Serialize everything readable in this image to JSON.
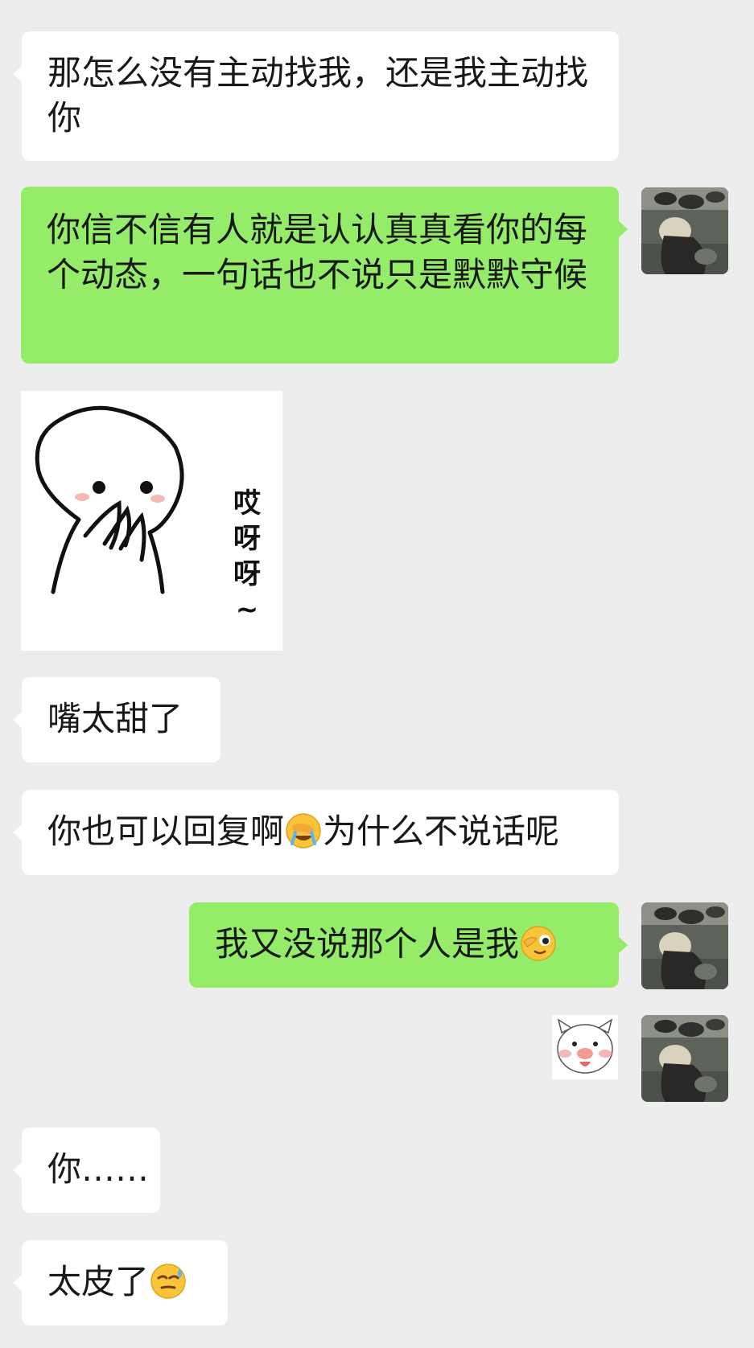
{
  "messages": [
    {
      "type": "text",
      "side": "incoming",
      "text": "那怎么没有主动找我，还是我主动找你"
    },
    {
      "type": "text",
      "side": "outgoing",
      "text": "你信不信有人就是认认真真看你的每个动态，一句话也不说只是默默守候"
    },
    {
      "type": "sticker",
      "side": "incoming",
      "text": "哎呀呀~",
      "icon": "shy-cover-mouth-sticker"
    },
    {
      "type": "text",
      "side": "incoming",
      "text": "嘴太甜了"
    },
    {
      "type": "text",
      "side": "incoming",
      "text_before": "你也可以回复啊",
      "emoji": "facepalm-crying-emoji",
      "text_after": "为什么不说话呢"
    },
    {
      "type": "text",
      "side": "outgoing",
      "text": "我又没说那个人是我",
      "emoji": "wink-hand-emoji"
    },
    {
      "type": "sticker",
      "side": "outgoing",
      "icon": "pig-face-sticker"
    },
    {
      "type": "text",
      "side": "incoming",
      "text": "你……"
    },
    {
      "type": "text",
      "side": "incoming",
      "text": "太皮了",
      "emoji": "smirk-sweat-emoji"
    }
  ],
  "colors": {
    "background": "#ededed",
    "incoming_bubble": "#ffffff",
    "outgoing_bubble": "#95ec69",
    "text": "#191919"
  }
}
